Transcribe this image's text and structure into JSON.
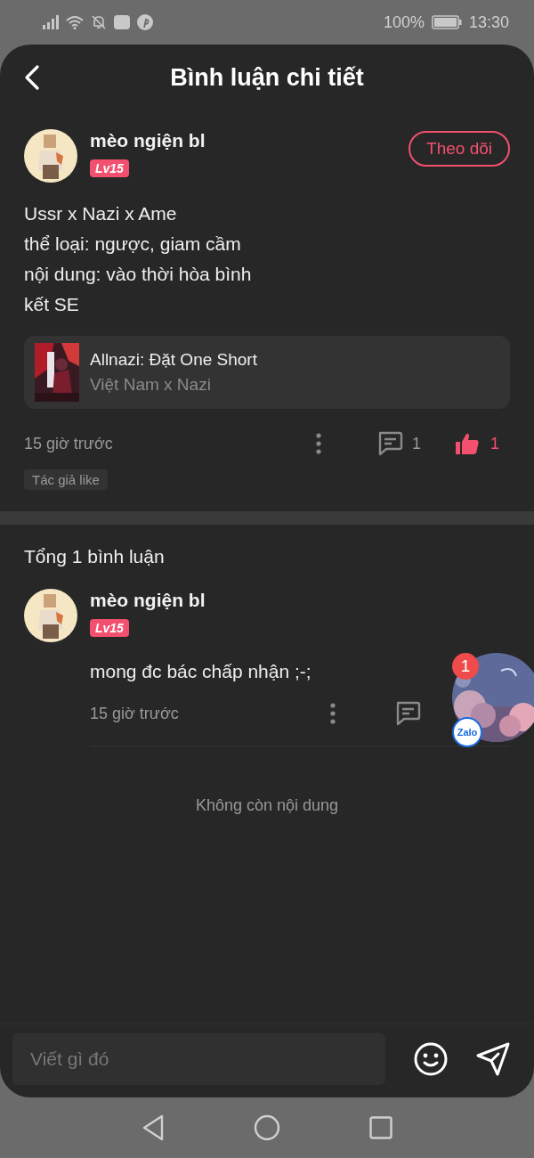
{
  "status_bar": {
    "battery": "100%",
    "time": "13:30"
  },
  "header": {
    "title": "Bình luận chi tiết"
  },
  "post": {
    "author": "mèo ngiện bl",
    "level_badge": "Lv15",
    "follow_button": "Theo dõi",
    "body_lines": [
      "Ussr x Nazi x Ame",
      "thể loại: ngược, giam cầm",
      "nội dung: vào thời hòa bình",
      "kết SE"
    ],
    "linked_story": {
      "title": "Allnazi: Đặt One Short",
      "subtitle": "Việt Nam x Nazi"
    },
    "time": "15 giờ trước",
    "comment_count": "1",
    "like_count": "1",
    "liked": true,
    "tag": "Tác giả like"
  },
  "comments_header": "Tổng 1 bình luận",
  "comments": [
    {
      "author": "mèo ngiện bl",
      "level_badge": "Lv15",
      "text": "mong đc bác chấp nhận ;-;",
      "time": "15 giờ trước"
    }
  ],
  "end_label": "Không còn nội dung",
  "chat_head": {
    "badge": "1",
    "app_label": "Zalo"
  },
  "composer": {
    "placeholder": "Viết gì đó"
  }
}
